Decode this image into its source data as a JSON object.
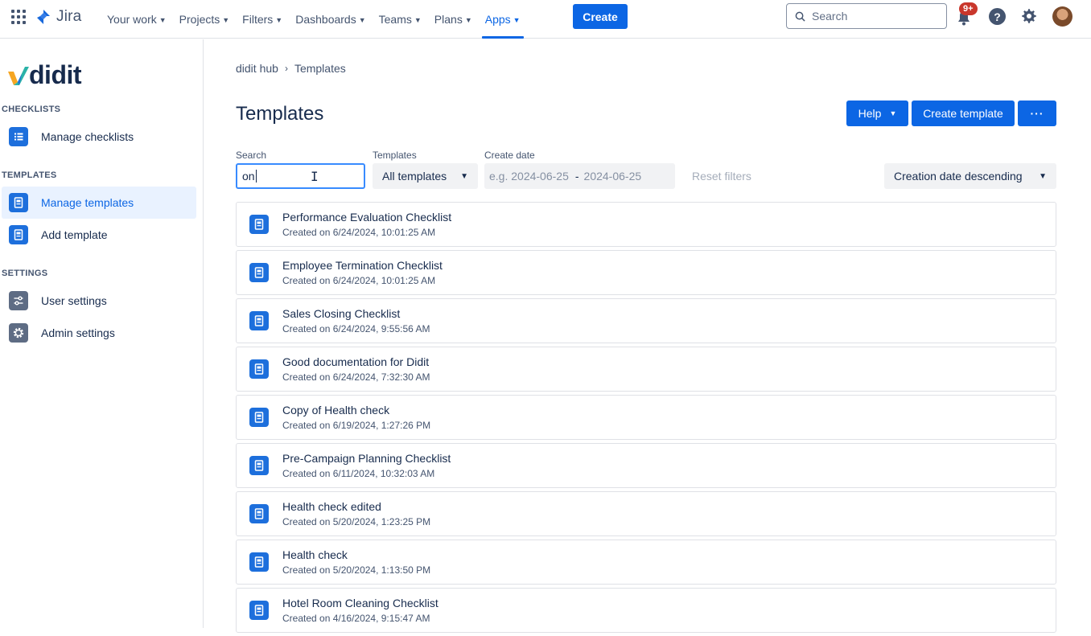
{
  "topnav": {
    "product": "Jira",
    "items": [
      {
        "label": "Your work"
      },
      {
        "label": "Projects"
      },
      {
        "label": "Filters"
      },
      {
        "label": "Dashboards"
      },
      {
        "label": "Teams"
      },
      {
        "label": "Plans"
      },
      {
        "label": "Apps",
        "active": true
      }
    ],
    "create_label": "Create",
    "search_placeholder": "Search",
    "notification_badge": "9+",
    "help_glyph": "?"
  },
  "sidebar": {
    "brand": "didit",
    "sections": {
      "checklists": "CHECKLISTS",
      "templates": "TEMPLATES",
      "settings": "SETTINGS"
    },
    "items": {
      "manage_checklists": "Manage checklists",
      "manage_templates": "Manage templates",
      "add_template": "Add template",
      "user_settings": "User settings",
      "admin_settings": "Admin settings"
    }
  },
  "breadcrumb": {
    "root": "didit hub",
    "separator": "›",
    "current": "Templates"
  },
  "page": {
    "title": "Templates",
    "help_button": "Help",
    "create_template_button": "Create template",
    "more_button": "···"
  },
  "filters": {
    "search_label": "Search",
    "search_value": "on",
    "templates_label": "Templates",
    "templates_value": "All templates",
    "create_date_label": "Create date",
    "date_from_placeholder": "e.g. 2024-06-25",
    "date_separator": "-",
    "date_to_placeholder": "2024-06-25",
    "reset_label": "Reset filters",
    "sort_value": "Creation date descending"
  },
  "templates": [
    {
      "title": "Performance Evaluation Checklist",
      "created": "Created on 6/24/2024, 10:01:25 AM"
    },
    {
      "title": "Employee Termination Checklist",
      "created": "Created on 6/24/2024, 10:01:25 AM"
    },
    {
      "title": "Sales Closing Checklist",
      "created": "Created on 6/24/2024, 9:55:56 AM"
    },
    {
      "title": "Good documentation for Didit",
      "created": "Created on 6/24/2024, 7:32:30 AM"
    },
    {
      "title": "Copy of Health check",
      "created": "Created on 6/19/2024, 1:27:26 PM"
    },
    {
      "title": "Pre-Campaign Planning Checklist",
      "created": "Created on 6/11/2024, 10:32:03 AM"
    },
    {
      "title": "Health check edited",
      "created": "Created on 5/20/2024, 1:23:25 PM"
    },
    {
      "title": "Health check",
      "created": "Created on 5/20/2024, 1:13:50 PM"
    },
    {
      "title": "Hotel Room Cleaning Checklist",
      "created": "Created on 4/16/2024, 9:15:47 AM"
    }
  ],
  "colors": {
    "accent": "#0c66e4",
    "selected_bg": "#e9f2ff",
    "badge": "#c9372c"
  }
}
